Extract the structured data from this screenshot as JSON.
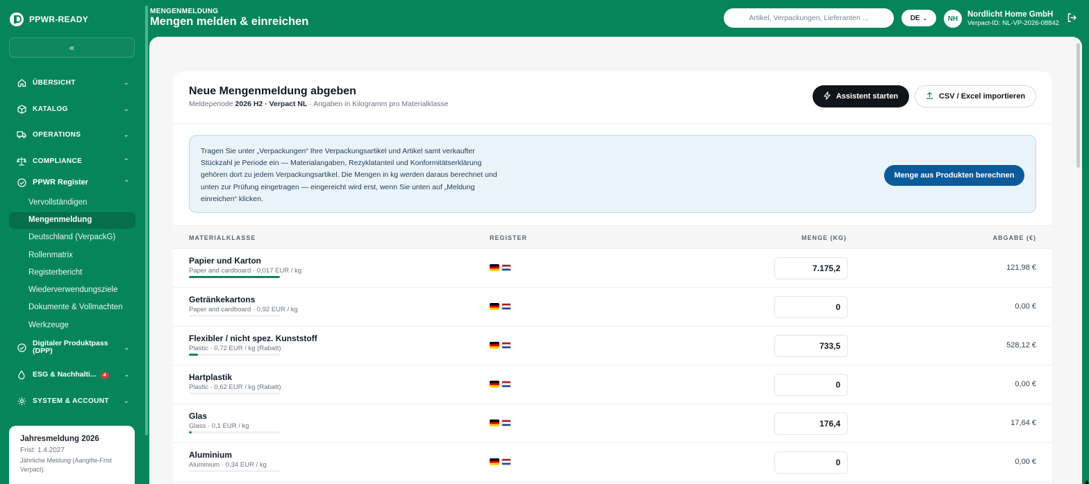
{
  "app": {
    "brand": "PPWR-READY"
  },
  "sidebar": {
    "collapse_label": "«",
    "sections": [
      {
        "label": "ÜBERSICHT",
        "icon": "home-icon",
        "chevron": "⌄"
      },
      {
        "label": "KATALOG",
        "icon": "box-icon",
        "chevron": "⌄"
      },
      {
        "label": "OPERATIONS",
        "icon": "truck-icon",
        "chevron": "⌄"
      },
      {
        "label": "COMPLIANCE",
        "icon": "scale-icon",
        "chevron": "⌃"
      }
    ],
    "register": {
      "label": "PPWR Register",
      "chevron": "⌃"
    },
    "sub_items": [
      "Vervollständigen",
      "Mengenmeldung",
      "Deutschland (VerpackG)",
      "Rollenmatrix",
      "Registerbericht",
      "Wiederverwendungsziele",
      "Dokumente & Vollmachten",
      "Werkzeuge"
    ],
    "active_index": 1,
    "dpp": {
      "label": "Digitaler Produktpass (DPP)",
      "chevron": "⌄"
    },
    "esg": {
      "label": "ESG & Nachhalti...",
      "badge": "4",
      "chevron": "⌄"
    },
    "system": {
      "label": "SYSTEM & ACCOUNT",
      "chevron": "⌄"
    },
    "deadline": {
      "title": "Jahresmeldung 2026",
      "frist": "Frist: 1.4.2027",
      "desc": "Jährliche Meldung (Aangifte-Frist Verpact)."
    }
  },
  "header": {
    "eyebrow": "MENGENMELDUNG",
    "title": "Mengen melden & einreichen",
    "search_placeholder": "Artikel, Verpackungen, Lieferanten ...",
    "lang": "DE",
    "avatar": "NH",
    "company": "Nordlicht Home GmbH",
    "verpact_id": "Verpact-ID: NL-VP-2026-08842"
  },
  "card": {
    "title": "Neue Mengenmeldung abgeben",
    "sub_prefix": "Meldeperiode ",
    "sub_period": "2026 H2 · Verpact NL",
    "sub_suffix": " · Angaben in Kilogramm pro Materialklasse",
    "btn_assistant": "Assistent starten",
    "btn_import": "CSV / Excel importieren",
    "info_text": "Tragen Sie unter „Verpackungen“ Ihre Verpackungsartikel und Artikel samt verkaufter Stückzahl je Periode ein — Materialangaben, Rezyklatanteil und Konformitätserklärung gehören dort zu jedem Verpackungsartikel. Die Mengen in kg werden daraus berechnet und unten zur Prüfung eingetragen — eingereicht wird erst, wenn Sie unten auf „Meldung einreichen“ klicken.",
    "btn_calc": "Menge aus Produkten berechnen"
  },
  "table": {
    "headers": {
      "material": "MATERIALKLASSE",
      "register": "REGISTER",
      "qty": "MENGE (KG)",
      "fee": "ABGABE (€)"
    },
    "rows": [
      {
        "name": "Papier und Karton",
        "meta": "Paper and cardboard · 0,017 EUR / kg",
        "qty": "7.175,2",
        "fee": "121,98 €",
        "share": 1.0
      },
      {
        "name": "Getränkekartons",
        "meta": "Paper and cardboard · 0,92 EUR / kg",
        "qty": "0",
        "fee": "0,00 €",
        "share": 0.0
      },
      {
        "name": "Flexibler / nicht spez. Kunststoff",
        "meta": "Plastic · 0,72 EUR / kg (Rabatt)",
        "qty": "733,5",
        "fee": "528,12 €",
        "share": 0.1
      },
      {
        "name": "Hartplastik",
        "meta": "Plastic · 0,62 EUR / kg (Rabatt)",
        "qty": "0",
        "fee": "0,00 €",
        "share": 0.0
      },
      {
        "name": "Glas",
        "meta": "Glass · 0,1 EUR / kg",
        "qty": "176,4",
        "fee": "17,64 €",
        "share": 0.03
      },
      {
        "name": "Aluminium",
        "meta": "Aluminium · 0,34 EUR / kg",
        "qty": "0",
        "fee": "0,00 €",
        "share": 0.0
      }
    ]
  },
  "colors": {
    "brand_green": "#07855a",
    "info_blue": "#0b5a9a",
    "dark": "#111418"
  }
}
